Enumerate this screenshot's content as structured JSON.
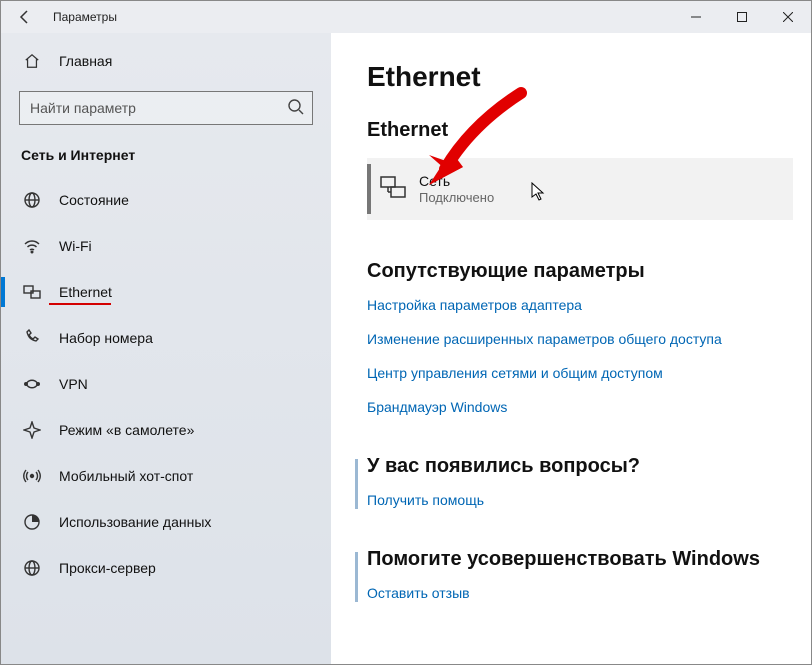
{
  "window": {
    "title": "Параметры"
  },
  "sidebar": {
    "home": "Главная",
    "search_placeholder": "Найти параметр",
    "section": "Сеть и Интернет",
    "items": [
      {
        "label": "Состояние"
      },
      {
        "label": "Wi-Fi"
      },
      {
        "label": "Ethernet"
      },
      {
        "label": "Набор номера"
      },
      {
        "label": "VPN"
      },
      {
        "label": "Режим «в самолете»"
      },
      {
        "label": "Мобильный хот-спот"
      },
      {
        "label": "Использование данных"
      },
      {
        "label": "Прокси-сервер"
      }
    ]
  },
  "main": {
    "title": "Ethernet",
    "subtitle": "Ethernet",
    "network": {
      "name": "Сеть",
      "status": "Подключено"
    },
    "related_title": "Сопутствующие параметры",
    "related_links": [
      "Настройка параметров адаптера",
      "Изменение расширенных параметров общего доступа",
      "Центр управления сетями и общим доступом",
      "Брандмауэр Windows"
    ],
    "help_title": "У вас появились вопросы?",
    "help_link": "Получить помощь",
    "feedback_title": "Помогите усовершенствовать Windows",
    "feedback_link": "Оставить отзыв"
  }
}
